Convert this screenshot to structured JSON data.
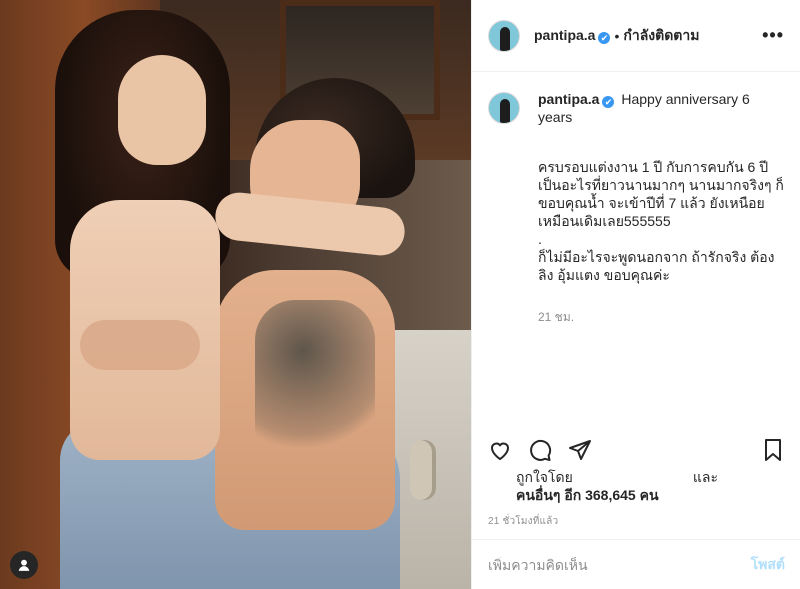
{
  "header": {
    "username": "pantipa.a",
    "verified_mark": "✔",
    "separator": "•",
    "follow_status": "กำลังติดตาม",
    "more_label": "•••"
  },
  "caption": {
    "username": "pantipa.a",
    "headline": "Happy anniversary 6 years",
    "lines": [
      "ครบรอบแต่งงาน 1 ปี กับการคบกัน 6 ปี เป็นอะไรที่ยาวนานมากๆ นานมากจริงๆ ก็ ขอบคุณน้ำ จะเข้าปีที่ 7 แล้ว ยังเหนือย เหมือนเดิมเลย555555",
      ".",
      "ก็ไม่มีอะไรจะพูดนอกจาก ถ้ารักจริง ต้องลิง อุ้มแตง ขอบคุณค่ะ"
    ],
    "time": "21 ชม."
  },
  "likes": {
    "liked_by_prefix": "ถูกใจโดย",
    "and": "และ",
    "others": "คนอื่นๆ อีก 368,645 คน"
  },
  "post_time": "21 ชั่วโมงที่แล้ว",
  "comment": {
    "placeholder": "เพิ่มความคิดเห็น",
    "post_label": "โพสต์"
  },
  "icons": {
    "like": "heart-icon",
    "comment": "comment-bubble-icon",
    "share": "paper-plane-icon",
    "save": "bookmark-icon",
    "profile": "user-icon"
  },
  "colors": {
    "verified": "#3897f0",
    "post_button": "#b2dffc",
    "muted": "#8e8e8e",
    "text": "#262626"
  }
}
